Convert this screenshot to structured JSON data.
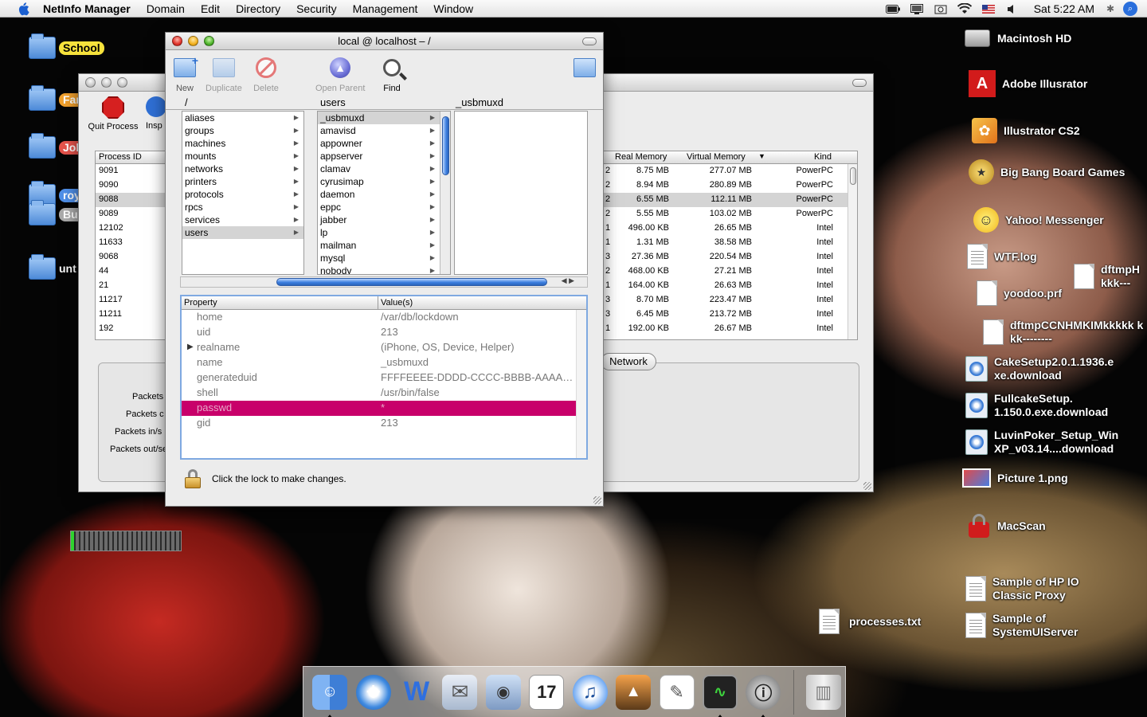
{
  "menubar": {
    "app_name": "NetInfo Manager",
    "menus": [
      "Domain",
      "Edit",
      "Directory",
      "Security",
      "Management",
      "Window"
    ],
    "clock": "Sat 5:22 AM"
  },
  "desktop_left": {
    "items": [
      {
        "label": "School",
        "tag_color": "#f6e23c"
      },
      {
        "label": "Fam",
        "tag_color": "#f2a12d"
      },
      {
        "label": "Job",
        "tag_color": "#e5534b"
      },
      {
        "label": "roy",
        "tag_color": "#4f8fe8"
      },
      {
        "label": "Bus",
        "tag_color": "#aaaaaa"
      },
      {
        "label": "unt",
        "tag_color": ""
      }
    ]
  },
  "desktop_right": {
    "items": [
      {
        "label": "Macintosh HD",
        "icon": "hard-drive-icon"
      },
      {
        "label": "Adobe Illusrator",
        "icon": "adobe-icon"
      },
      {
        "label": "Illustrator CS2",
        "icon": "illustrator-icon"
      },
      {
        "label": "Big Bang Board Games",
        "icon": "games-icon"
      },
      {
        "label": "Yahoo! Messenger",
        "icon": "yahoo-icon"
      },
      {
        "label": "WTF.log",
        "icon": "document-icon"
      },
      {
        "label": "yoodoo.prf",
        "icon": "document-icon"
      },
      {
        "label": "dftmpCCNHMKIMkkkkk kkk--------",
        "icon": "document-icon"
      },
      {
        "label": "dftmpH kkk---",
        "icon": "document-icon"
      },
      {
        "label": "CakeSetup2.0.1.1936.e xe.download",
        "icon": "download-icon"
      },
      {
        "label": "FullcakeSetup. 1.150.0.exe.download",
        "icon": "download-icon"
      },
      {
        "label": "LuvinPoker_Setup_Win XP_v03.14....download",
        "icon": "download-icon"
      },
      {
        "label": "Picture 1.png",
        "icon": "image-icon"
      },
      {
        "label": "MacScan",
        "icon": "lock-icon"
      },
      {
        "label": "Sample of HP IO Classic Proxy",
        "icon": "document-icon"
      },
      {
        "label": "Sample of SystemUIServer",
        "icon": "document-icon"
      },
      {
        "label": "processes.txt",
        "icon": "document-icon"
      }
    ]
  },
  "activity_monitor": {
    "toolbar": {
      "quit_label": "Quit Process",
      "inspect_label": "Insp"
    },
    "columns": {
      "pid": "Process ID",
      "real_memory": "Real Memory",
      "virtual_memory": "Virtual Memory",
      "kind": "Kind"
    },
    "rows": [
      {
        "pid": "9091",
        "c2": "2",
        "rm": "8.75 MB",
        "vm": "277.07 MB",
        "kind": "PowerPC"
      },
      {
        "pid": "9090",
        "c2": "2",
        "rm": "8.94 MB",
        "vm": "280.89 MB",
        "kind": "PowerPC"
      },
      {
        "pid": "9088",
        "c2": "2",
        "rm": "6.55 MB",
        "vm": "112.11 MB",
        "kind": "PowerPC"
      },
      {
        "pid": "9089",
        "c2": "2",
        "rm": "5.55 MB",
        "vm": "103.02 MB",
        "kind": "PowerPC"
      },
      {
        "pid": "12102",
        "c2": "1",
        "rm": "496.00 KB",
        "vm": "26.65 MB",
        "kind": "Intel"
      },
      {
        "pid": "11633",
        "c2": "1",
        "rm": "1.31 MB",
        "vm": "38.58 MB",
        "kind": "Intel"
      },
      {
        "pid": "9068",
        "c2": "3",
        "rm": "27.36 MB",
        "vm": "220.54 MB",
        "kind": "Intel"
      },
      {
        "pid": "44",
        "c2": "2",
        "rm": "468.00 KB",
        "vm": "27.21 MB",
        "kind": "Intel"
      },
      {
        "pid": "21",
        "c2": "1",
        "rm": "164.00 KB",
        "vm": "26.63 MB",
        "kind": "Intel"
      },
      {
        "pid": "11217",
        "c2": "3",
        "rm": "8.70 MB",
        "vm": "223.47 MB",
        "kind": "Intel"
      },
      {
        "pid": "11211",
        "c2": "3",
        "rm": "6.45 MB",
        "vm": "213.72 MB",
        "kind": "Intel"
      },
      {
        "pid": "192",
        "c2": "1",
        "rm": "192.00 KB",
        "vm": "26.67 MB",
        "kind": "Intel"
      }
    ],
    "tab_label": "Network",
    "panel_labels": [
      "Packets",
      "Packets c",
      "Packets in/s",
      "Packets out/se"
    ]
  },
  "netinfo": {
    "title": "local @ localhost – /",
    "toolbar": {
      "new": "New",
      "duplicate": "Duplicate",
      "delete": "Delete",
      "open_parent": "Open Parent",
      "find": "Find"
    },
    "column_headers": [
      "/",
      "users",
      "_usbmuxd"
    ],
    "col1": [
      "aliases",
      "groups",
      "machines",
      "mounts",
      "networks",
      "printers",
      "protocols",
      "rpcs",
      "services",
      "users"
    ],
    "col2": [
      "_usbmuxd",
      "amavisd",
      "appowner",
      "appserver",
      "clamav",
      "cyrusimap",
      "daemon",
      "eppc",
      "jabber",
      "lp",
      "mailman",
      "mysql",
      "nobody"
    ],
    "props_headers": {
      "property": "Property",
      "value": "Value(s)"
    },
    "props": [
      {
        "k": "home",
        "v": "/var/db/lockdown"
      },
      {
        "k": "uid",
        "v": "213"
      },
      {
        "k": "realname",
        "v": "(iPhone, OS, Device, Helper)"
      },
      {
        "k": "name",
        "v": "_usbmuxd"
      },
      {
        "k": "generateduid",
        "v": "FFFFEEEE-DDDD-CCCC-BBBB-AAAA…"
      },
      {
        "k": "shell",
        "v": "/usr/bin/false"
      },
      {
        "k": "passwd",
        "v": "*"
      },
      {
        "k": "gid",
        "v": "213"
      }
    ],
    "lock_text": "Click the lock to make changes."
  },
  "activity_meter": {
    "level": 0.03
  },
  "colors": {
    "highlight_magenta": "#c8006a",
    "selection_grey": "#d4d4d4",
    "aqua_blue": "#3d7fe0"
  }
}
